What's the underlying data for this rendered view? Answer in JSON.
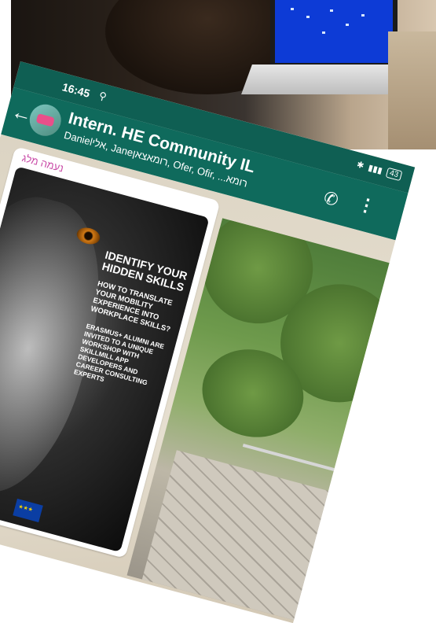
{
  "status_bar": {
    "time": "16:45",
    "battery": "43"
  },
  "chat": {
    "title": "Intern. HE Community IL",
    "members": "Danielאלי, Janeרומאצאן, Ofer, Ofir, ...רומא"
  },
  "message": {
    "sender": "נעמה מלג",
    "poster": {
      "heading": "IDENTIFY YOUR HIDDEN SKILLS",
      "subheading": "HOW TO TRANSLATE YOUR MOBILITY EXPERIENCE INTO WORKPLACE SKILLS?",
      "body": "ERASMUS+ ALUMNI ARE INVITED TO A UNIQUE WORKSHOP WITH SKILLMILL APP DEVELOPERS AND CAREER CONSULTING EXPERTS"
    }
  },
  "colors": {
    "header_green": "#0f6a5c",
    "status_green": "#0f5f53",
    "sender_pink": "#c94aa7"
  },
  "icons": [
    "back-arrow-icon",
    "add-call-icon",
    "more-vert-icon",
    "location-icon",
    "bluetooth-icon",
    "signal-icon",
    "battery-icon"
  ]
}
